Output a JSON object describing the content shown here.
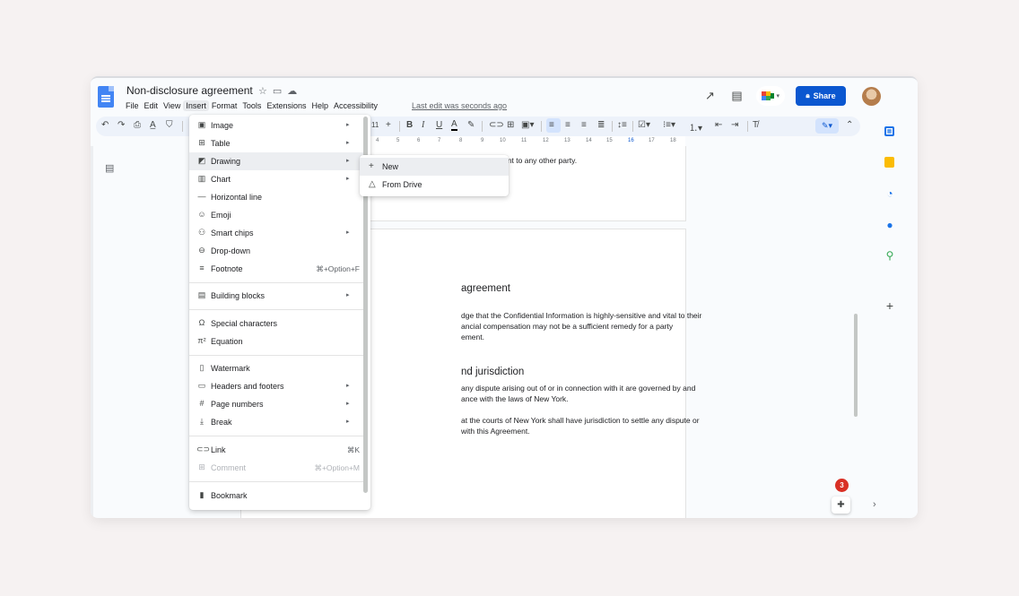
{
  "app": {
    "title": "Non-disclosure agreement",
    "last_edit": "Last edit was seconds ago",
    "menus": [
      "File",
      "Edit",
      "View",
      "Insert",
      "Format",
      "Tools",
      "Extensions",
      "Help",
      "Accessibility"
    ],
    "share_label": "Share",
    "accent": "#0b57d0"
  },
  "toolbar": {
    "font_size": "11",
    "icons": [
      "undo-icon",
      "redo-icon",
      "print-icon",
      "spellcheck-icon",
      "paint-format-icon",
      "decrease-font-icon",
      "increase-font-icon",
      "bold-icon",
      "italic-icon",
      "underline-icon",
      "text-color-icon",
      "highlight-icon",
      "link-icon",
      "comment-icon",
      "image-icon",
      "align-left-icon",
      "align-center-icon",
      "align-right-icon",
      "justify-icon",
      "line-spacing-icon",
      "checklist-icon",
      "bulleted-list-icon",
      "numbered-list-icon",
      "decrease-indent-icon",
      "increase-indent-icon",
      "clear-formatting-icon",
      "editing-mode-icon",
      "collapse-icon"
    ]
  },
  "ruler": [
    "4",
    "5",
    "6",
    "7",
    "8",
    "9",
    "10",
    "11",
    "12",
    "13",
    "14",
    "15",
    "16",
    "17",
    "18"
  ],
  "insert_menu": {
    "items": [
      {
        "icon": "image-icon",
        "label": "Image",
        "submenu": true
      },
      {
        "icon": "table-icon",
        "label": "Table",
        "submenu": true
      },
      {
        "icon": "drawing-icon",
        "label": "Drawing",
        "submenu": true
      },
      {
        "icon": "chart-icon",
        "label": "Chart",
        "submenu": true
      },
      {
        "icon": "horizontal-line-icon",
        "label": "Horizontal line"
      },
      {
        "icon": "emoji-icon",
        "label": "Emoji"
      },
      {
        "icon": "smart-chips-icon",
        "label": "Smart chips",
        "submenu": true
      },
      {
        "icon": "dropdown-icon",
        "label": "Drop-down"
      },
      {
        "icon": "footnote-icon",
        "label": "Footnote",
        "shortcut": "⌘+Option+F"
      },
      {
        "icon": "building-blocks-icon",
        "label": "Building blocks",
        "submenu": true
      },
      {
        "icon": "omega-icon",
        "label": "Special characters"
      },
      {
        "icon": "equation-icon",
        "label": "Equation"
      },
      {
        "icon": "watermark-icon",
        "label": "Watermark"
      },
      {
        "icon": "headers-footers-icon",
        "label": "Headers and footers",
        "submenu": true
      },
      {
        "icon": "hash-icon",
        "label": "Page numbers",
        "submenu": true
      },
      {
        "icon": "break-icon",
        "label": "Break",
        "submenu": true
      },
      {
        "icon": "link-icon",
        "label": "Link",
        "shortcut": "⌘K"
      },
      {
        "icon": "comment-icon",
        "label": "Comment",
        "shortcut": "⌘+Option+M",
        "disabled": true
      },
      {
        "icon": "bookmark-icon",
        "label": "Bookmark"
      }
    ]
  },
  "drawing_submenu": {
    "items": [
      {
        "icon": "plus-icon",
        "label": "New"
      },
      {
        "icon": "drive-icon",
        "label": "From Drive"
      }
    ]
  },
  "document": {
    "page1_line": "greement to any other party.",
    "heading1": "agreement",
    "para1": [
      "dge that the Confidential Information is highly-sensitive and vital to their",
      "ancial compensation may not be a sufficient remedy for a party",
      "ement."
    ],
    "heading2": "nd jurisdiction",
    "para2": [
      "any dispute arising out of or in connection with it are governed by and",
      "ance with the laws of New York."
    ],
    "para3": [
      "at the courts of New York shall have jurisdiction to settle any dispute or",
      "with this Agreement."
    ]
  },
  "side_panel": {
    "icons": [
      "calendar-icon",
      "keep-icon",
      "tasks-icon",
      "contacts-icon",
      "maps-icon",
      "add-icon"
    ],
    "badge": "3"
  }
}
